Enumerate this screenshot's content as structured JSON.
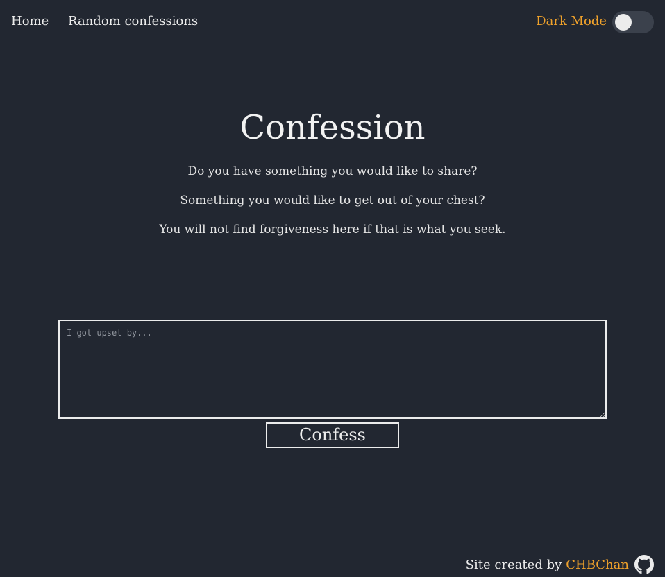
{
  "nav": {
    "home_label": "Home",
    "random_label": "Random confessions"
  },
  "dark_mode": {
    "label": "Dark Mode",
    "enabled": false
  },
  "main": {
    "title": "Confession",
    "lines": [
      "Do you have something you would like to share?",
      "Something you would like to get out of your chest?",
      "You will not find forgiveness here if that is what you seek."
    ]
  },
  "form": {
    "placeholder": "I got upset by...",
    "value": "",
    "submit_label": "Confess"
  },
  "footer": {
    "text": "Site created by",
    "author": "CHBChan",
    "icon": "github-icon"
  },
  "colors": {
    "background": "#222731",
    "accent": "#f0a22b",
    "text": "#ececec",
    "toggle_track": "#3b414c"
  }
}
